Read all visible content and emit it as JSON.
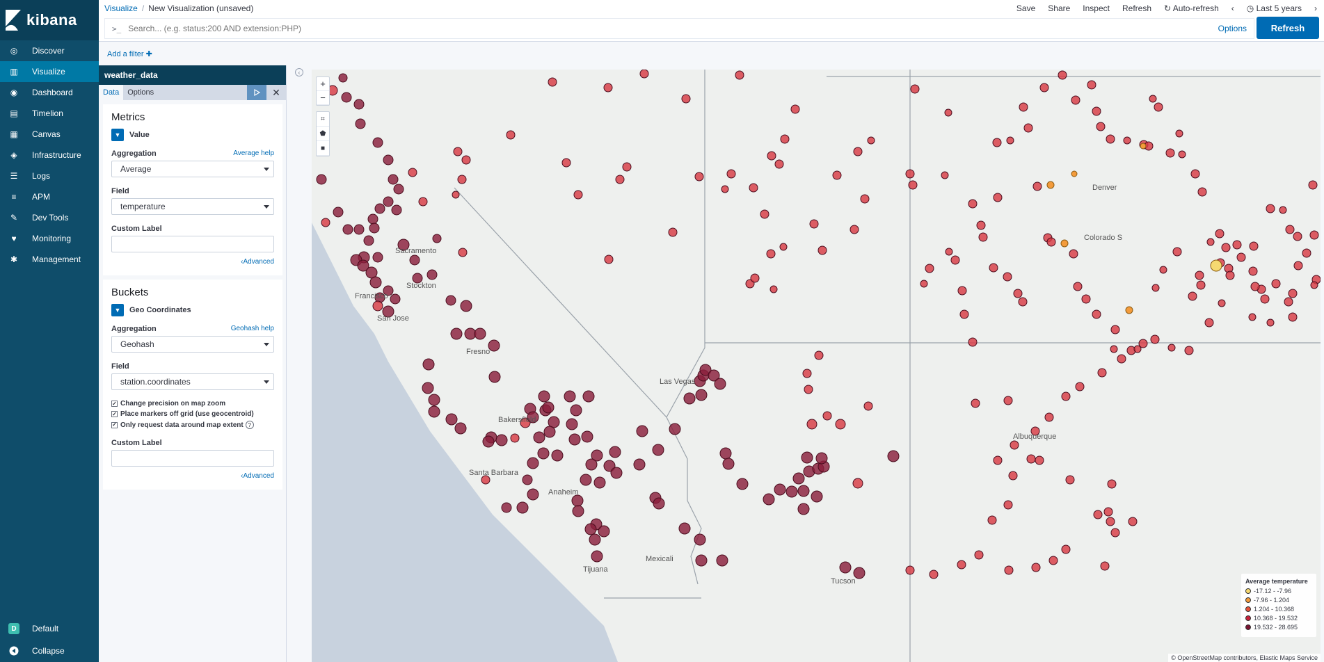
{
  "app": {
    "brand": "kibana",
    "nav": [
      {
        "label": "Discover",
        "icon": "compass-icon"
      },
      {
        "label": "Visualize",
        "icon": "bar-chart-icon",
        "active": true
      },
      {
        "label": "Dashboard",
        "icon": "dashboard-icon"
      },
      {
        "label": "Timelion",
        "icon": "timelion-icon"
      },
      {
        "label": "Canvas",
        "icon": "canvas-icon"
      },
      {
        "label": "Infrastructure",
        "icon": "infrastructure-icon"
      },
      {
        "label": "Logs",
        "icon": "logs-icon"
      },
      {
        "label": "APM",
        "icon": "apm-icon"
      },
      {
        "label": "Dev Tools",
        "icon": "wrench-icon"
      },
      {
        "label": "Monitoring",
        "icon": "heartbeat-icon"
      },
      {
        "label": "Management",
        "icon": "gear-icon"
      }
    ],
    "bottom": {
      "space_label": "Default",
      "space_letter": "D",
      "collapse_label": "Collapse"
    }
  },
  "topbar": {
    "crumb_root": "Visualize",
    "crumb_sep": "/",
    "crumb_current": "New Visualization (unsaved)",
    "menu": [
      "Save",
      "Share",
      "Inspect",
      "Refresh"
    ],
    "auto_refresh": "Auto-refresh",
    "time_range": "Last 5 years"
  },
  "search": {
    "prompt": ">_",
    "placeholder": "Search... (e.g. status:200 AND extension:PHP)",
    "options_label": "Options",
    "refresh_label": "Refresh"
  },
  "filters": {
    "add_label": "Add a filter"
  },
  "editor": {
    "index": "weather_data",
    "tabs": [
      "Data",
      "Options"
    ],
    "metrics": {
      "title": "Metrics",
      "agg_name": "Value",
      "aggregation_label": "Aggregation",
      "aggregation_help": "Average help",
      "aggregation_value": "Average",
      "field_label": "Field",
      "field_value": "temperature",
      "custom_label": "Custom Label",
      "advanced": "Advanced"
    },
    "buckets": {
      "title": "Buckets",
      "agg_name": "Geo Coordinates",
      "aggregation_label": "Aggregation",
      "aggregation_help": "Geohash help",
      "aggregation_value": "Geohash",
      "field_label": "Field",
      "field_value": "station.coordinates",
      "checks": [
        "Change precision on map zoom",
        "Place markers off grid (use geocentroid)",
        "Only request data around map extent"
      ],
      "custom_label": "Custom Label",
      "advanced": "Advanced"
    }
  },
  "map": {
    "cities": [
      {
        "name": "Sacramento"
      },
      {
        "name": "Stockton"
      },
      {
        "name": "Francisco"
      },
      {
        "name": "San Jose"
      },
      {
        "name": "Fresno"
      },
      {
        "name": "Bakersfield"
      },
      {
        "name": "Santa Barbara"
      },
      {
        "name": "Anaheim"
      },
      {
        "name": "Tijuana"
      },
      {
        "name": "Mexicali"
      },
      {
        "name": "Las Vegas"
      },
      {
        "name": "Tucson"
      },
      {
        "name": "Albuquerque"
      },
      {
        "name": "Denver"
      },
      {
        "name": "Colorado S"
      }
    ],
    "legend": {
      "title": "Average temperature",
      "items": [
        {
          "label": "-17.12 - -7.96",
          "color": "#f6d971"
        },
        {
          "label": "-7.96 - 1.204",
          "color": "#f39b3b"
        },
        {
          "label": "1.204 - 10.368",
          "color": "#e7523a"
        },
        {
          "label": "10.368 - 19.532",
          "color": "#c9203a"
        },
        {
          "label": "19.532 - 28.695",
          "color": "#7a1331"
        }
      ]
    },
    "attribution": "© OpenStreetMap contributors, Elastic Maps Service",
    "colors": {
      "accent": "#006bb4",
      "nav": "#0f4d6a",
      "nav_active": "#0079a5"
    }
  }
}
